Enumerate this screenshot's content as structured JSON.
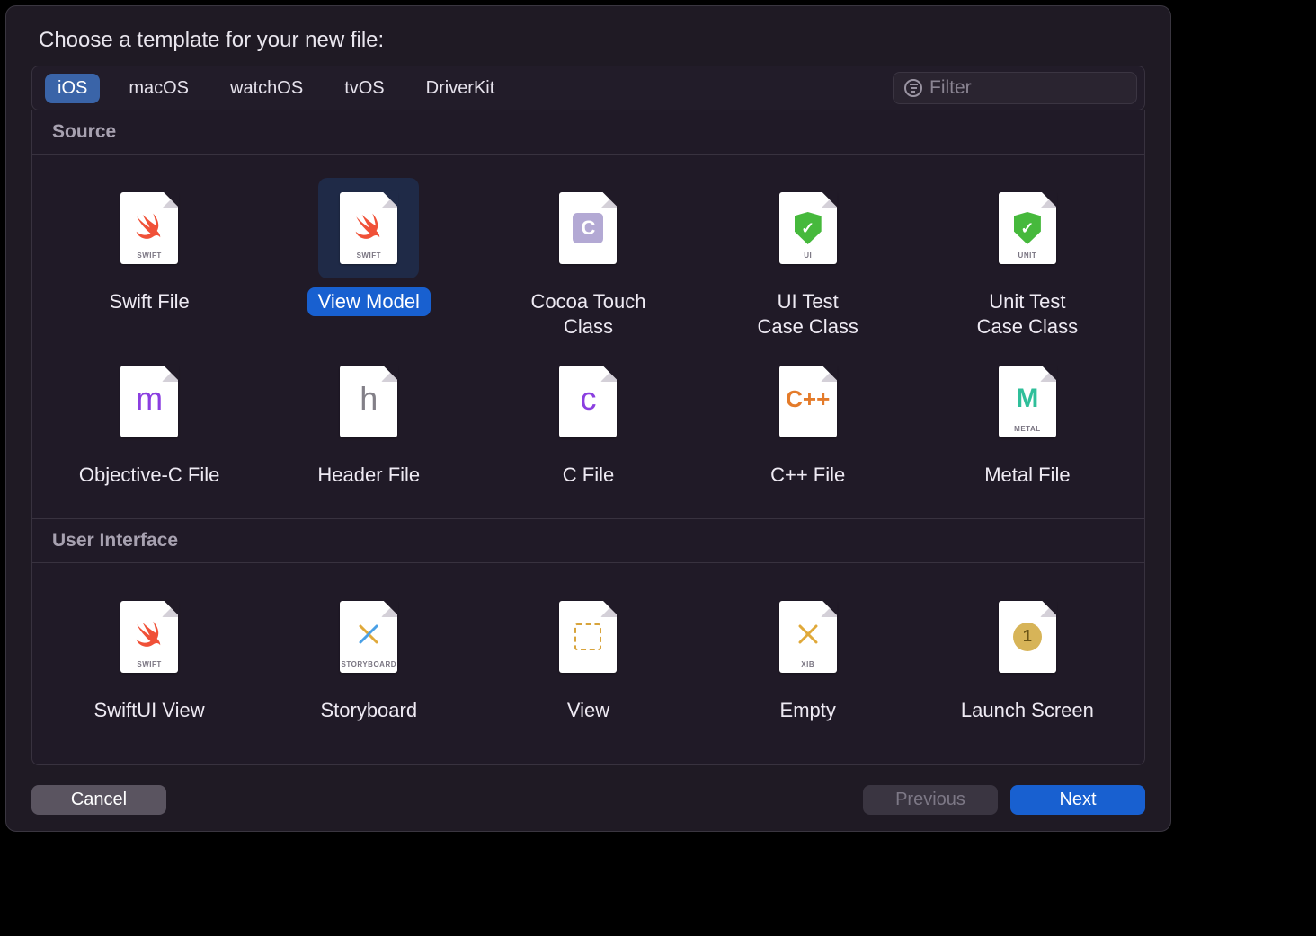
{
  "title": "Choose a template for your new file:",
  "platforms": [
    "iOS",
    "macOS",
    "watchOS",
    "tvOS",
    "DriverKit"
  ],
  "selected_platform": 0,
  "filter_placeholder": "Filter",
  "sections": [
    {
      "name": "Source",
      "items": [
        {
          "label": "Swift File",
          "icon": "swift",
          "badge": "SWIFT"
        },
        {
          "label": "View Model",
          "icon": "swift",
          "badge": "SWIFT",
          "selected": true
        },
        {
          "label": "Cocoa Touch\nClass",
          "icon": "cocoa",
          "badge": ""
        },
        {
          "label": "UI Test\nCase Class",
          "icon": "shield",
          "badge": "UI"
        },
        {
          "label": "Unit Test\nCase Class",
          "icon": "shield",
          "badge": "UNIT"
        },
        {
          "label": "Objective-C File",
          "icon": "m",
          "badge": ""
        },
        {
          "label": "Header File",
          "icon": "h",
          "badge": ""
        },
        {
          "label": "C File",
          "icon": "c",
          "badge": ""
        },
        {
          "label": "C++ File",
          "icon": "cpp",
          "badge": ""
        },
        {
          "label": "Metal File",
          "icon": "metal",
          "badge": "METAL"
        }
      ]
    },
    {
      "name": "User Interface",
      "items": [
        {
          "label": "SwiftUI View",
          "icon": "swift",
          "badge": "SWIFT"
        },
        {
          "label": "Storyboard",
          "icon": "storyboard",
          "badge": "STORYBOARD"
        },
        {
          "label": "View",
          "icon": "view",
          "badge": ""
        },
        {
          "label": "Empty",
          "icon": "xib",
          "badge": "XIB"
        },
        {
          "label": "Launch Screen",
          "icon": "launch",
          "badge": ""
        }
      ]
    }
  ],
  "buttons": {
    "cancel": "Cancel",
    "previous": "Previous",
    "next": "Next"
  }
}
